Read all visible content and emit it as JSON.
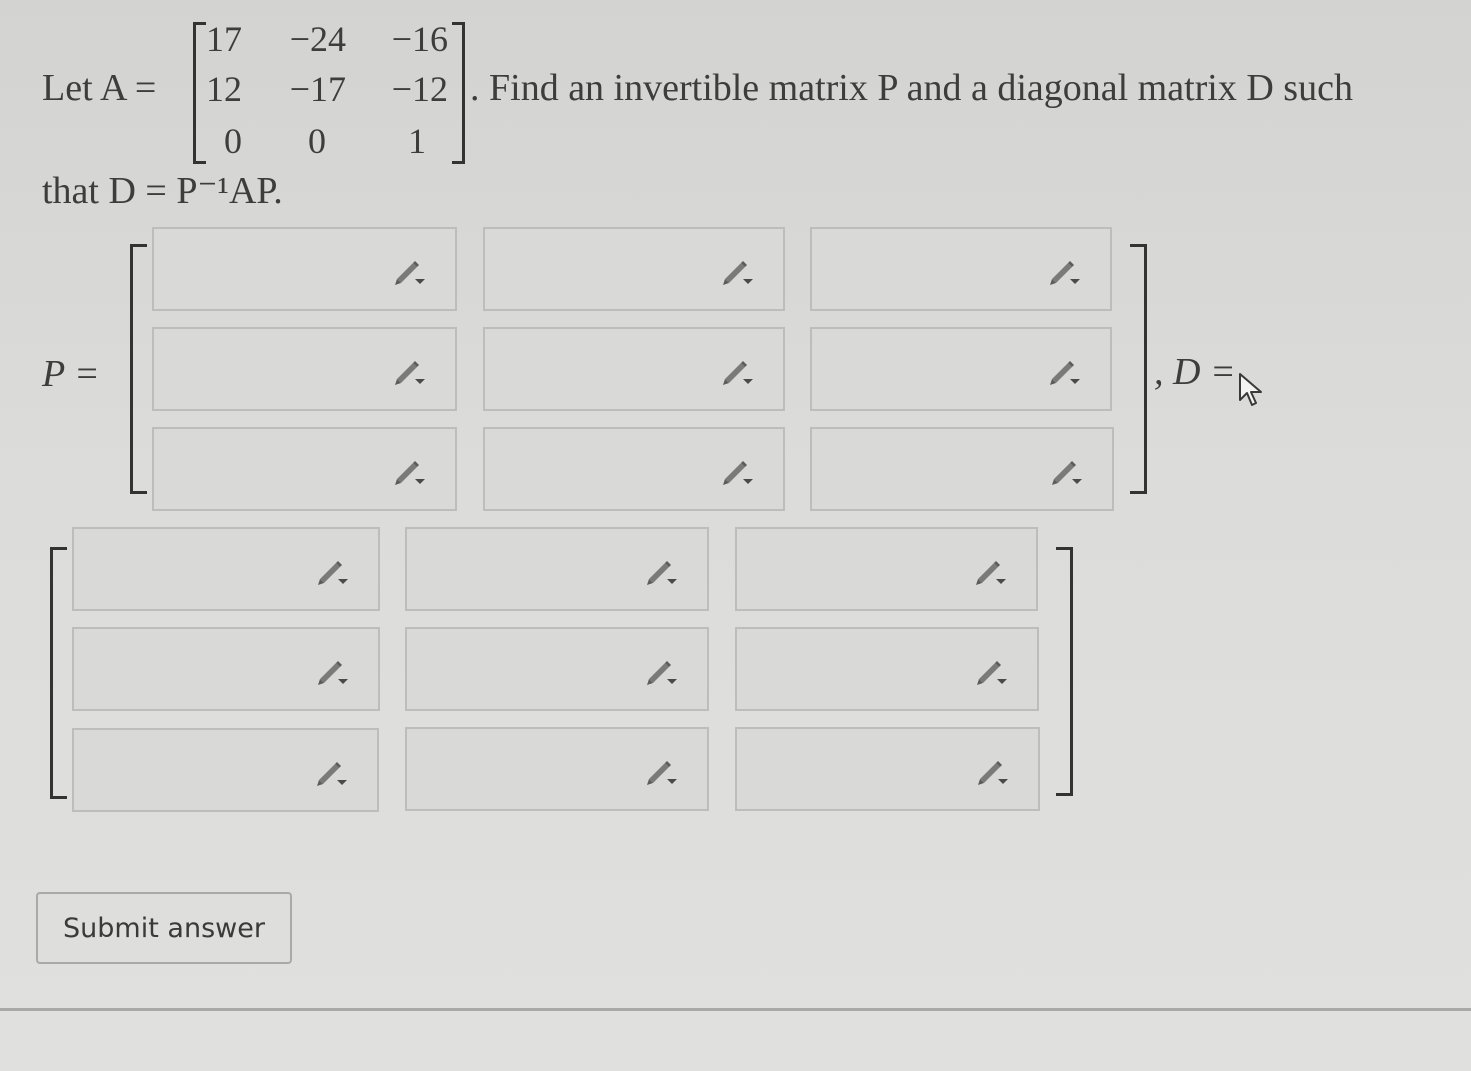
{
  "question": {
    "let_label": "Let A =",
    "matrix_A": [
      [
        "17",
        "−24",
        "−16"
      ],
      [
        "12",
        "−17",
        "−12"
      ],
      [
        "0",
        "0",
        "1"
      ]
    ],
    "sentence_rest": ". Find an invertible matrix P and a diagonal matrix D such",
    "line2": "that D = P⁻¹AP."
  },
  "p_label": "P =",
  "d_label": ", D =",
  "pencil_icon": "pencil-dropdown-icon",
  "submit_label": "Submit answer"
}
